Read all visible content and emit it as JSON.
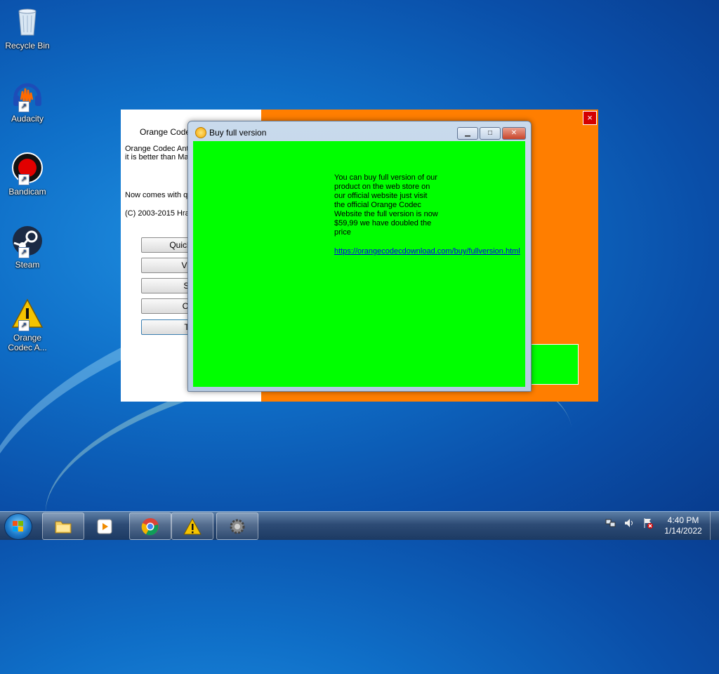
{
  "desktop": {
    "icons": [
      {
        "label": "Recycle Bin",
        "icon": "recycle-bin-icon"
      },
      {
        "label": "Audacity",
        "icon": "audacity-icon"
      },
      {
        "label": "Bandicam",
        "icon": "bandicam-icon"
      },
      {
        "label": "Steam",
        "icon": "steam-icon"
      },
      {
        "label": "Orange Codec A...",
        "icon": "warning-icon"
      }
    ]
  },
  "main_window": {
    "title": "Orange Codec",
    "description": "Orange Codec Anti great protection fro it is better than Mal and 360 TOTAL S",
    "line_now": "Now comes with qu",
    "copyright": "(C) 2003-2015 Hras",
    "buttons": [
      "Quick Scan",
      "Virus",
      "Spe",
      "Clea",
      "Too"
    ],
    "close_label": "×",
    "colors": {
      "orange": "#ff7e00",
      "green": "#00ff00"
    }
  },
  "dialog": {
    "title": "Buy full version",
    "message": "You can buy full version of our product on the web store on our official website just visit the official Orange Codec Website the full version is now $59,99 we have doubled the price",
    "link": "https://orangecodecdownload.com/buy/fullversion.html",
    "minimize_label": "▁",
    "maximize_label": "□",
    "close_label": "✕"
  },
  "taskbar": {
    "items": [
      "start-button",
      "explorer-icon",
      "media-player-icon",
      "chrome-icon",
      "warning-icon",
      "settings-icon"
    ],
    "tray_icons": [
      "network-icon",
      "volume-icon",
      "action-center-icon"
    ],
    "time": "4:40 PM",
    "date": "1/14/2022"
  }
}
